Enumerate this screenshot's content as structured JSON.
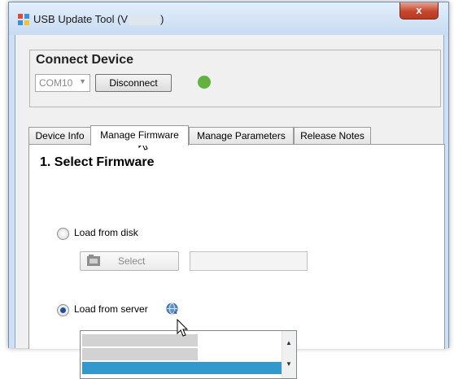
{
  "window": {
    "title_prefix": "USB Update Tool  (V",
    "title_suffix": ")",
    "close_label": "x",
    "app_icon": "windows-app-icon"
  },
  "connect": {
    "title": "Connect Device",
    "port_value": "COM10",
    "disconnect_label": "Disconnect",
    "status_color": "#62b23f"
  },
  "tabs": [
    {
      "label": "Device Info",
      "active": false
    },
    {
      "label": "Manage Firmware",
      "active": true
    },
    {
      "label": "Manage Parameters",
      "active": false
    },
    {
      "label": "Release Notes",
      "active": false
    }
  ],
  "firmware": {
    "section_title": "1. Select Firmware",
    "load_disk_label": "Load from disk",
    "load_disk_checked": false,
    "select_button_label": "Select",
    "path_value": "",
    "load_server_label": "Load from server",
    "load_server_checked": true,
    "globe_icon": "globe-icon",
    "server_list_selected_index": 2
  },
  "colors": {
    "selection": "#3399cc",
    "status_green": "#62b23f"
  }
}
